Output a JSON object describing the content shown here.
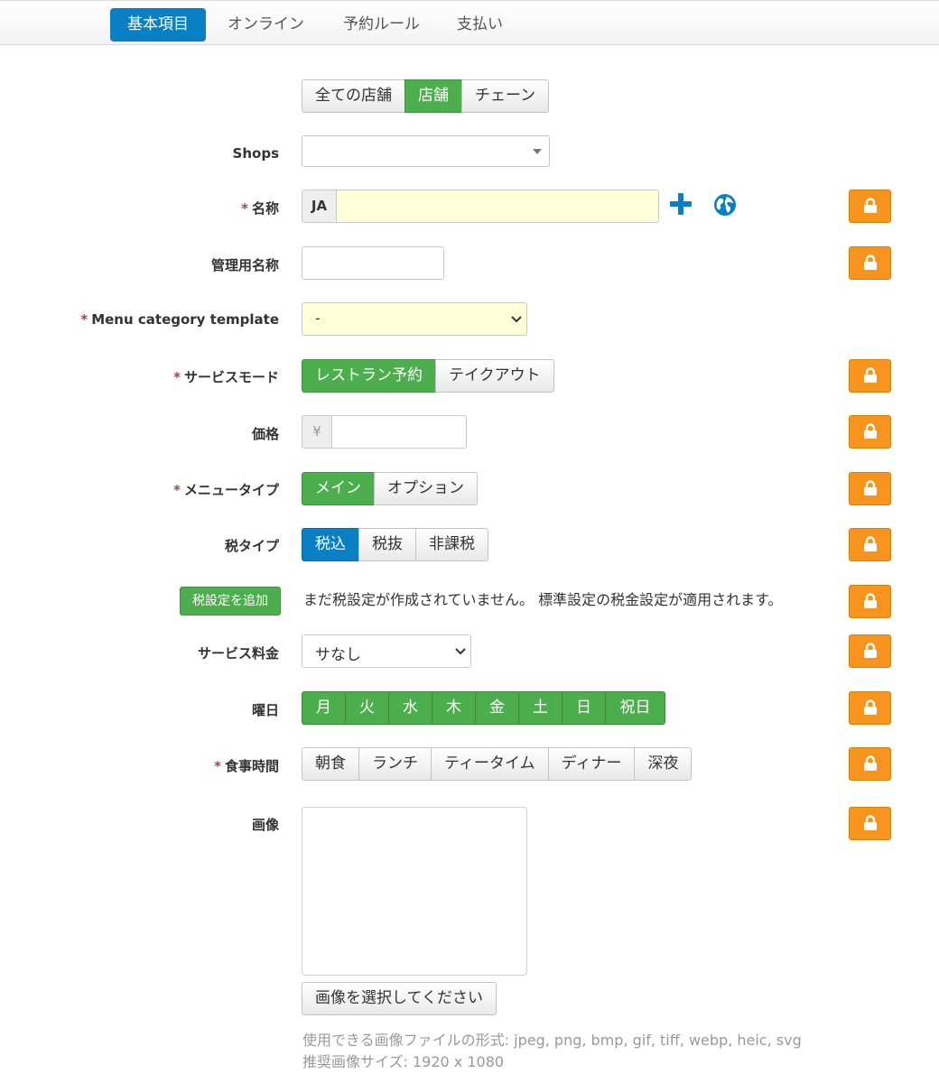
{
  "tabs": [
    "基本項目",
    "オンライン",
    "予約ルール",
    "支払い"
  ],
  "scope": {
    "options": [
      "全ての店舗",
      "店舗",
      "チェーン"
    ]
  },
  "shops": {
    "label": "Shops",
    "value": ""
  },
  "name": {
    "required_mark": "*",
    "label": "名称",
    "lang": "JA",
    "value": ""
  },
  "admin_name": {
    "label": "管理用名称",
    "value": ""
  },
  "menu_category_template": {
    "required_mark": "*",
    "label": "Menu category template",
    "value": "-"
  },
  "service_mode": {
    "required_mark": "*",
    "label": "サービスモード",
    "options": [
      "レストラン予約",
      "テイクアウト"
    ],
    "selected": "レストラン予約"
  },
  "price": {
    "label": "価格",
    "currency": "¥",
    "value": ""
  },
  "menu_type": {
    "required_mark": "*",
    "label": "メニュータイプ",
    "options": [
      "メイン",
      "オプション"
    ],
    "selected": "メイン"
  },
  "tax_type": {
    "label": "税タイプ",
    "options": [
      "税込",
      "税抜",
      "非課税"
    ],
    "selected": "税込"
  },
  "tax_setting": {
    "button": "税設定を追加",
    "message": "まだ税設定が作成されていません。 標準設定の税金設定が適用されます。"
  },
  "service_charge": {
    "label": "サービス料金",
    "value": "サなし"
  },
  "weekdays": {
    "label": "曜日",
    "options": [
      "月",
      "火",
      "水",
      "木",
      "金",
      "土",
      "日",
      "祝日"
    ]
  },
  "meal_time": {
    "required_mark": "*",
    "label": "食事時間",
    "options": [
      "朝食",
      "ランチ",
      "ティータイム",
      "ディナー",
      "深夜"
    ]
  },
  "image": {
    "label": "画像",
    "select_button": "画像を選択してください",
    "formats_hint": "使用できる画像ファイルの形式: jpeg, png, bmp, gif, tiff, webp, heic, svg",
    "size_hint": "推奨画像サイズ: 1920 x 1080"
  },
  "icons": {
    "lock": "lock-icon",
    "add": "plus-icon",
    "translate": "globe-icon"
  },
  "colors": {
    "primary": "#0a80c4",
    "success": "#4cae4c",
    "lock": "#f7941d",
    "required_field": "#fefed8"
  }
}
